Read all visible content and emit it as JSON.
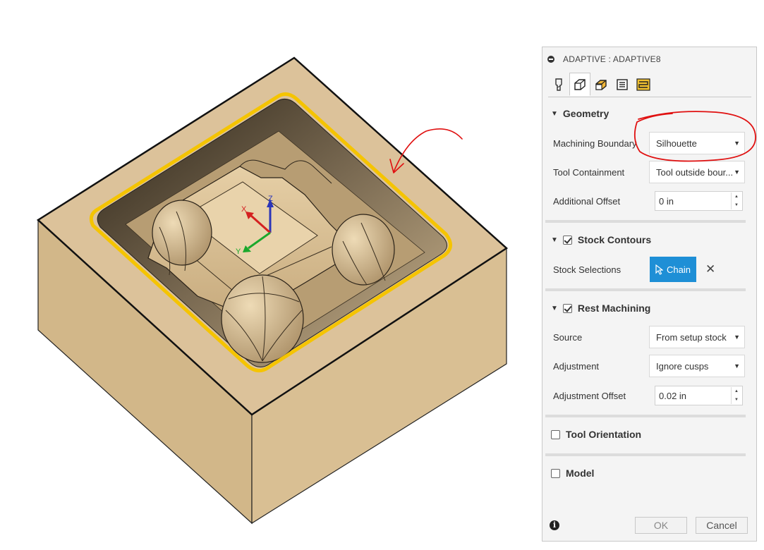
{
  "viewport": {
    "part_color": "#dcc29a",
    "boundary_highlight_color": "#f5c400",
    "annotation_color": "#e01010",
    "triad": {
      "x_label": "X",
      "y_label": "Y",
      "z_label": "Z"
    }
  },
  "dialog": {
    "title": "ADAPTIVE : ADAPTIVE8",
    "tabs": [
      {
        "icon": "tool-icon"
      },
      {
        "icon": "geometry-icon",
        "active": true
      },
      {
        "icon": "heights-icon"
      },
      {
        "icon": "passes-icon"
      },
      {
        "icon": "linking-icon"
      }
    ],
    "geometry": {
      "heading": "Geometry",
      "machining_boundary": {
        "label": "Machining Boundary",
        "value": "Silhouette"
      },
      "tool_containment": {
        "label": "Tool Containment",
        "value": "Tool outside bour..."
      },
      "additional_offset": {
        "label": "Additional Offset",
        "value": "0 in"
      }
    },
    "stock_contours": {
      "heading": "Stock Contours",
      "checked": true,
      "stock_selections_label": "Stock Selections",
      "chain_label": "Chain",
      "clear_label": "✕"
    },
    "rest_machining": {
      "heading": "Rest Machining",
      "checked": true,
      "source": {
        "label": "Source",
        "value": "From setup stock"
      },
      "adjustment": {
        "label": "Adjustment",
        "value": "Ignore cusps"
      },
      "adjustment_offset": {
        "label": "Adjustment Offset",
        "value": "0.02 in"
      }
    },
    "tool_orientation": {
      "heading": "Tool Orientation",
      "checked": false
    },
    "model": {
      "heading": "Model",
      "checked": false
    },
    "footer": {
      "info": "i",
      "ok_label": "OK",
      "cancel_label": "Cancel"
    },
    "accent_color": "#1e8fd6"
  }
}
